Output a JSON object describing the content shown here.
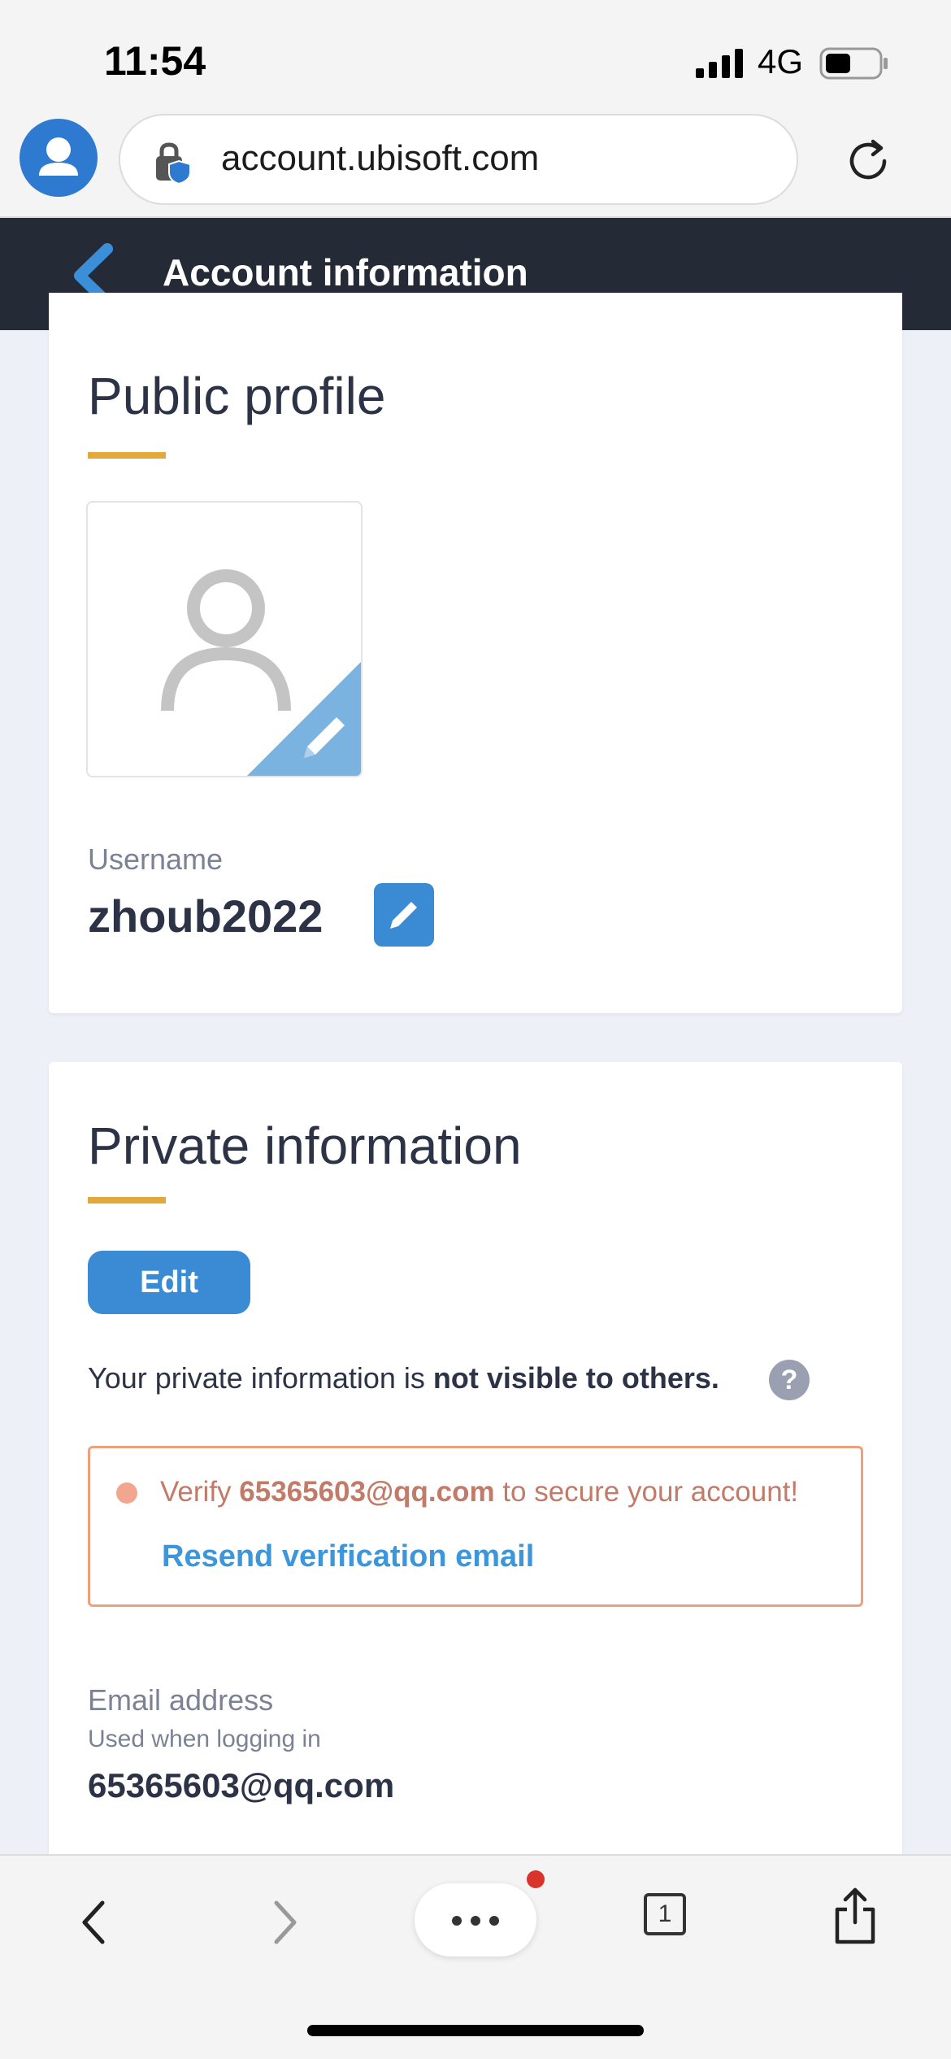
{
  "status_bar": {
    "time": "11:54",
    "network": "4G"
  },
  "browser": {
    "url": "account.ubisoft.com",
    "icons": [
      "profile-avatar-icon",
      "lock-shield-icon",
      "reload-icon"
    ]
  },
  "header": {
    "title": "Account information",
    "back_icon": "chevron-left-icon"
  },
  "public_profile": {
    "title": "Public profile",
    "username_label": "Username",
    "username_value": "zhoub2022"
  },
  "private_info": {
    "title": "Private information",
    "edit_label": "Edit",
    "note_prefix": "Your private information is ",
    "note_bold": "not visible to others.",
    "help_label": "?",
    "verify_prefix": "Verify ",
    "verify_email": "65365603@qq.com",
    "verify_suffix": " to secure your account!",
    "resend_label": "Resend verification email",
    "email_label": "Email address",
    "email_sublabel": "Used when logging in",
    "email_value": "65365603@qq.com"
  },
  "toolbar": {
    "tabs_count": "1"
  },
  "colors": {
    "header_bg": "#252b36",
    "accent_blue": "#3a8bd4",
    "underline_gold": "#e2a93a",
    "warning_border": "#efa07a",
    "notification_red": "#d9342b"
  }
}
